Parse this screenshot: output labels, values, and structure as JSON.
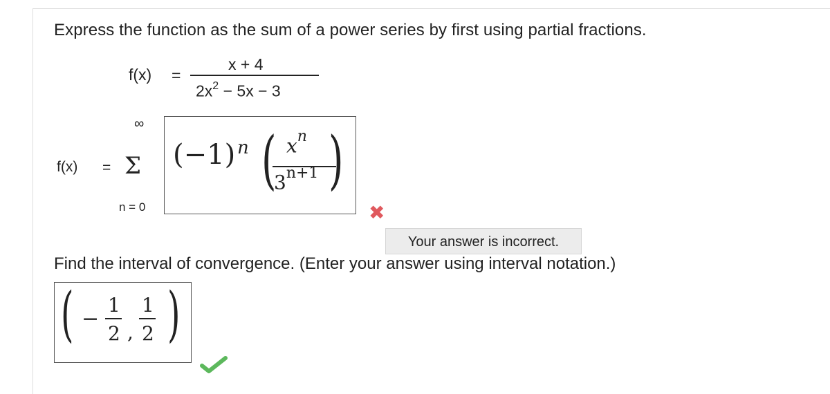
{
  "question": {
    "prompt": "Express the function as the sum of a power series by first using partial fractions.",
    "function": {
      "lhs": "f(x)",
      "equals": "=",
      "numerator": "x + 4",
      "denominator_base": "2x",
      "denominator_exp": "2",
      "denominator_rest": " − 5x − 3"
    }
  },
  "series": {
    "lhs": "f(x)",
    "equals": "=",
    "upper_limit": "∞",
    "sigma": "Σ",
    "lower_limit": "n = 0",
    "answer": {
      "sign_base": "(−1)",
      "sign_exp": "n",
      "paren_left": "(",
      "paren_right": ")",
      "num_base": "x",
      "num_exp": "n",
      "den_base": "3",
      "den_exp": "n+1"
    },
    "status_icon": "x-mark-icon",
    "status_color": "#e0595e",
    "feedback": "Your answer is incorrect."
  },
  "interval": {
    "prompt": "Find the interval of convergence. (Enter your answer using interval notation.)",
    "answer": {
      "paren_left": "(",
      "paren_right": ")",
      "minus": "−",
      "left_num": "1",
      "left_den": "2",
      "comma": ",",
      "right_num": "1",
      "right_den": "2"
    },
    "status_icon": "check-mark-icon",
    "status_color": "#5cb85c"
  }
}
